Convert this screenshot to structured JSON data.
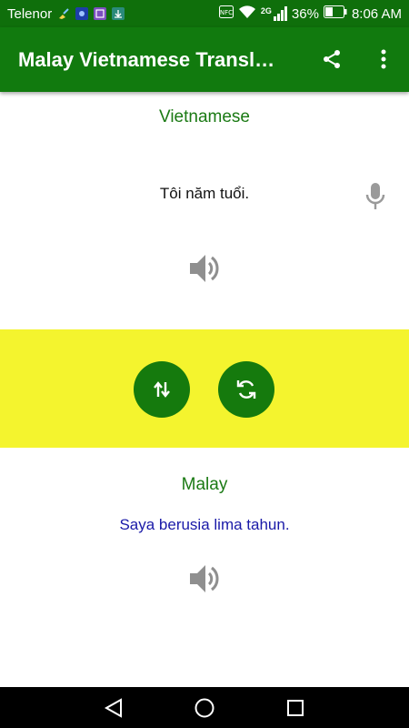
{
  "status_bar": {
    "carrier": "Telenor",
    "network_label": "2G",
    "battery_percent": "36%",
    "time": "8:06 AM",
    "icons": [
      "broom-notification-icon",
      "messenger-notification-icon",
      "gallery-notification-icon",
      "download-notification-icon",
      "nfc-icon",
      "wifi-icon",
      "signal-icon",
      "battery-icon"
    ]
  },
  "app_bar": {
    "title": "Malay Vietnamese Transl…",
    "actions": [
      "share-icon",
      "overflow-menu-icon"
    ]
  },
  "source": {
    "language": "Vietnamese",
    "text": "Tôi năm tuổi.",
    "icons": [
      "microphone-icon",
      "speaker-icon"
    ]
  },
  "controls": {
    "band_color": "#f4f42e",
    "button_color": "#157a0d",
    "buttons": [
      "swap-languages-button",
      "translate-refresh-button"
    ]
  },
  "target": {
    "language": "Malay",
    "text": "Saya berusia lima tahun.",
    "icons": [
      "speaker-icon"
    ]
  },
  "nav_bar": {
    "buttons": [
      "back-icon",
      "home-icon",
      "recent-apps-icon"
    ]
  },
  "colors": {
    "status_bar": "#0f6f0b",
    "app_bar": "#117a0e",
    "language_label": "#1b7a14",
    "translated_text": "#1a1aa8"
  }
}
